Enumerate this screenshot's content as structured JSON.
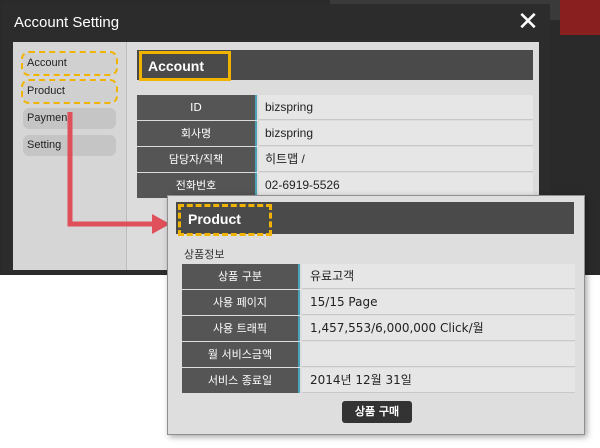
{
  "modal": {
    "title": "Account Setting",
    "close_glyph": "✕"
  },
  "sidebar": {
    "items": [
      {
        "label": "Account",
        "highlighted": true
      },
      {
        "label": "Product",
        "highlighted": true
      },
      {
        "label": "Payment",
        "highlighted": false
      },
      {
        "label": "Setting",
        "highlighted": false
      }
    ]
  },
  "account": {
    "header": "Account",
    "rows": [
      {
        "key": "ID",
        "value": "bizspring"
      },
      {
        "key": "회사명",
        "value": "bizspring"
      },
      {
        "key": "담당자/직책",
        "value": "히트맵 /"
      },
      {
        "key": "전화번호",
        "value": "02-6919-5526"
      }
    ]
  },
  "product": {
    "header": "Product",
    "section_title": "상품정보",
    "rows": [
      {
        "key": "상품 구분",
        "value": "유료고객"
      },
      {
        "key": "사용 페이지",
        "value": "15/15 Page"
      },
      {
        "key": "사용 트래픽",
        "value": "1,457,553/6,000,000 Click/월"
      },
      {
        "key": "월 서비스금액",
        "value": ""
      },
      {
        "key": "서비스 종료일",
        "value": "2014년 12월 31일"
      }
    ],
    "buy_button": "상품 구매"
  },
  "colors": {
    "highlight": "#f0b400",
    "arrow": "#e0505a",
    "key_cell": "#555555",
    "key_divider": "#4aa3b8"
  },
  "icons": {
    "close": "close-icon",
    "connector": "arrow-right-icon"
  }
}
